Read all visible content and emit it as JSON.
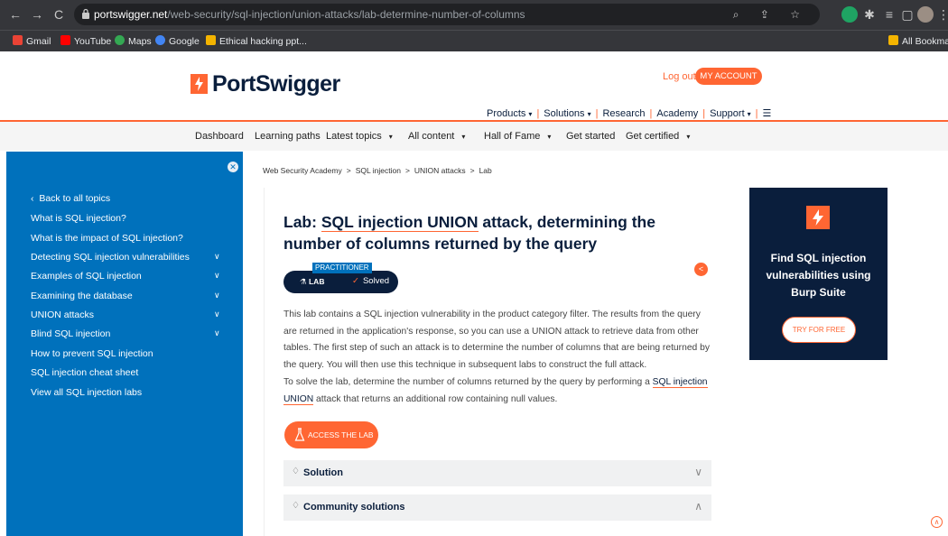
{
  "browser": {
    "url_host": "portswigger.net",
    "url_path": "/web-security/sql-injection/union-attacks/lab-determine-number-of-columns",
    "bookmarks": [
      "Gmail",
      "YouTube",
      "Maps",
      "Google",
      "Ethical hacking ppt...",
      "All Bookmarks"
    ]
  },
  "header": {
    "logo_text": "PortSwigger",
    "logout": "Log out",
    "my_account": "MY ACCOUNT",
    "nav": [
      "Products",
      "Solutions",
      "Research",
      "Academy",
      "Support"
    ]
  },
  "subnav": [
    "Dashboard",
    "Learning paths",
    "Latest topics",
    "All content",
    "Hall of Fame",
    "Get started",
    "Get certified"
  ],
  "sidebar": {
    "back": "Back to all topics",
    "items": [
      {
        "label": "What is SQL injection?",
        "expandable": false
      },
      {
        "label": "What is the impact of SQL injection?",
        "expandable": false
      },
      {
        "label": "Detecting SQL injection vulnerabilities",
        "expandable": true
      },
      {
        "label": "Examples of SQL injection",
        "expandable": true
      },
      {
        "label": "Examining the database",
        "expandable": true
      },
      {
        "label": "UNION attacks",
        "expandable": true
      },
      {
        "label": "Blind SQL injection",
        "expandable": true
      },
      {
        "label": "How to prevent SQL injection",
        "expandable": false
      },
      {
        "label": "SQL injection cheat sheet",
        "expandable": false
      },
      {
        "label": "View all SQL injection labs",
        "expandable": false
      }
    ]
  },
  "breadcrumb": [
    "Web Security Academy",
    "SQL injection",
    "UNION attacks",
    "Lab"
  ],
  "lab": {
    "title_prefix": "Lab: ",
    "title_highlight": "SQL injection UNION",
    "title_rest": " attack, determining the number of columns returned by the query",
    "level": "PRACTITIONER",
    "lab_label": "LAB",
    "status": "Solved",
    "para1": "This lab contains a SQL injection vulnerability in the product category filter. The results from the query are returned in the application's response, so you can use a UNION attack to retrieve data from other tables. The first step of such an attack is to determine the number of columns that are being returned by the query. You will then use this technique in subsequent labs to construct the full attack.",
    "para2_a": "To solve the lab, determine the number of columns returned by the query by performing a ",
    "para2_link": "SQL injection UNION",
    "para2_b": " attack that returns an additional row containing null values.",
    "access_button": "ACCESS THE LAB",
    "solution_label": "Solution",
    "community_label": "Community solutions"
  },
  "promo": {
    "text": "Find SQL injection vulnerabilities using Burp Suite",
    "button": "TRY FOR FREE"
  },
  "colors": {
    "brand_orange": "#ff6633",
    "navy": "#0a1e3c",
    "sidebar_blue": "#0071bc"
  }
}
